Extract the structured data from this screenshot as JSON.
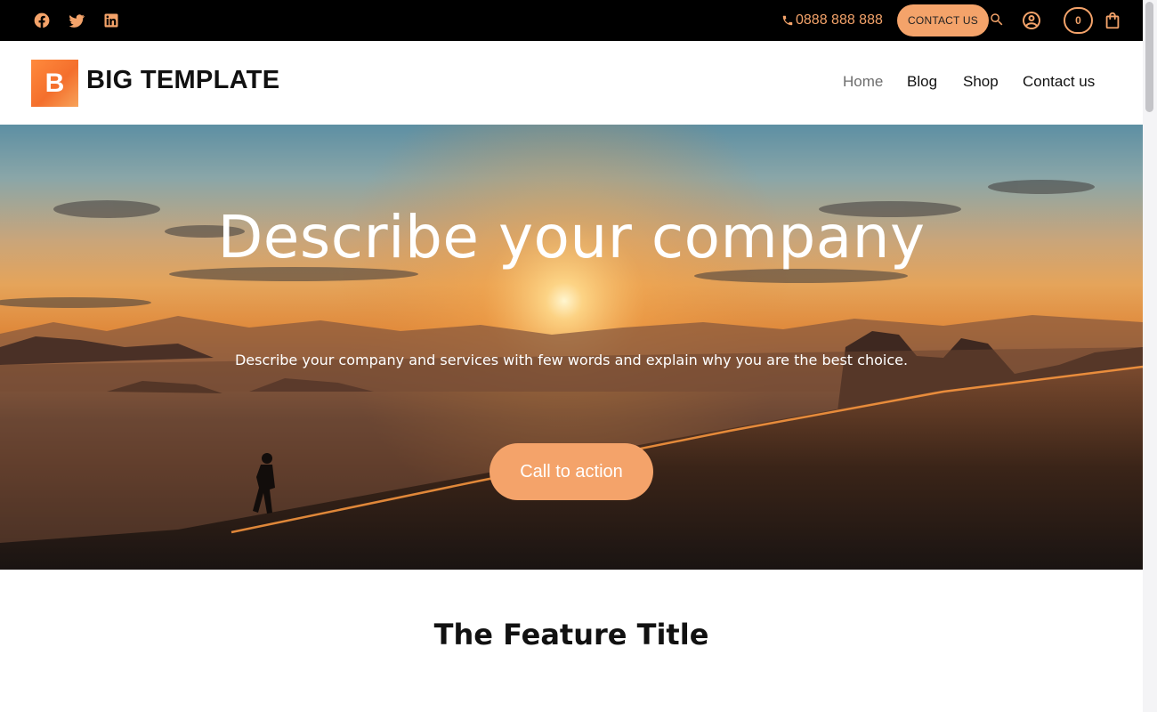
{
  "topbar": {
    "social": [
      {
        "name": "facebook",
        "icon": "facebook-icon"
      },
      {
        "name": "twitter",
        "icon": "twitter-icon"
      },
      {
        "name": "linkedin",
        "icon": "linkedin-icon"
      }
    ],
    "phone": "0888 888 888",
    "contact_button": "CONTACT US",
    "cart_count": "0"
  },
  "header": {
    "logo_letter": "B",
    "logo_text": "BIG TEMPLATE",
    "nav": [
      {
        "label": "Home",
        "active": true
      },
      {
        "label": "Blog",
        "active": false
      },
      {
        "label": "Shop",
        "active": false
      },
      {
        "label": "Contact us",
        "active": false
      }
    ]
  },
  "hero": {
    "title": "Describe your company",
    "subtitle": "Describe your company and services with few words and explain why you are the best choice.",
    "cta_label": "Call to action"
  },
  "features": {
    "title": "The Feature Title"
  },
  "colors": {
    "accent": "#f4a36a",
    "topbar_bg": "#000000",
    "text": "#111111"
  }
}
